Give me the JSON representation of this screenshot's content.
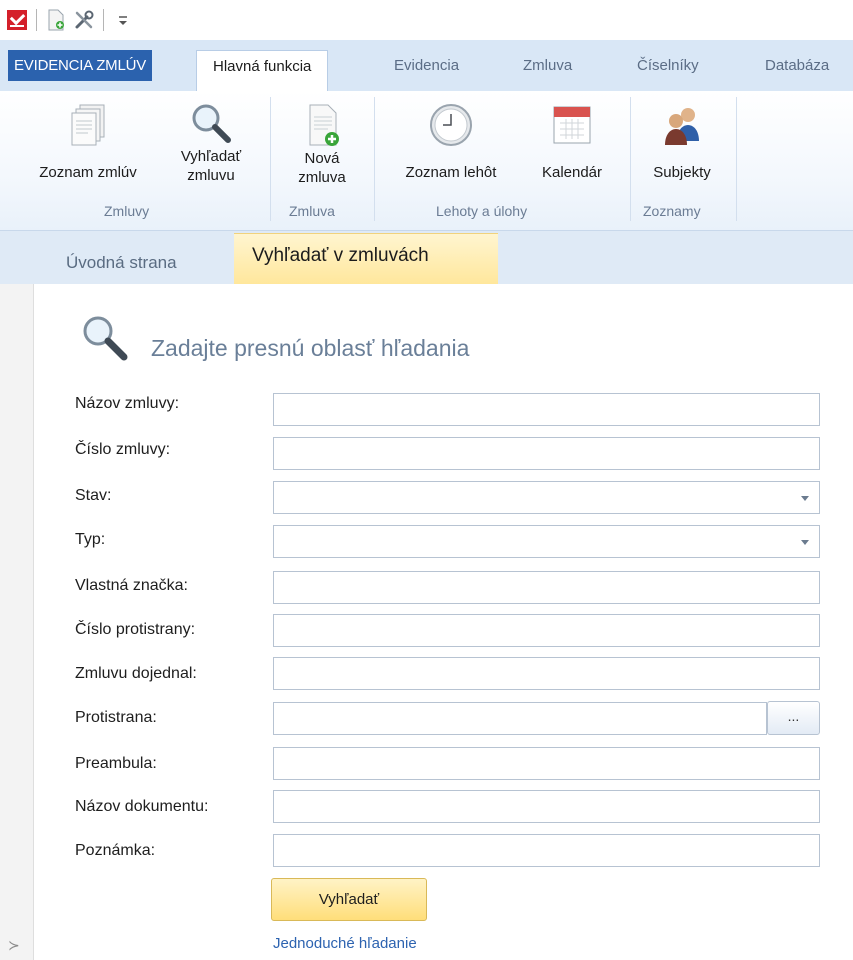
{
  "app_tab": "EVIDENCIA ZMLÚV",
  "ribbon_tabs": [
    "Hlavná funkcia",
    "Evidencia",
    "Zmluva",
    "Číselníky",
    "Databáza"
  ],
  "ribbon": {
    "buttons": {
      "contracts_list": "Zoznam zmlúv",
      "search_contract_1": "Vyhľadať",
      "search_contract_2": "zmluvu",
      "new_contract_1": "Nová",
      "new_contract_2": "zmluva",
      "deadlines_list": "Zoznam lehôt",
      "calendar": "Kalendár",
      "subjects": "Subjekty"
    },
    "groups": {
      "contracts": "Zmluvy",
      "contract": "Zmluva",
      "deadlines": "Lehoty a úlohy",
      "lists": "Zoznamy"
    }
  },
  "doc_tabs": {
    "home": "Úvodná strana",
    "search": "Vyhľadať v zmluvách"
  },
  "form": {
    "title": "Zadajte presnú oblasť hľadania",
    "fields": {
      "contract_name": "Názov zmluvy:",
      "contract_number": "Číslo zmluvy:",
      "status": "Stav:",
      "type": "Typ:",
      "own_mark": "Vlastná značka:",
      "counterparty_number": "Číslo protistrany:",
      "negotiated_by": "Zmluvu dojednal:",
      "counterparty": "Protistrana:",
      "preamble": "Preambula:",
      "document_name": "Názov dokumentu:",
      "note": "Poznámka:"
    },
    "values": {
      "contract_name": "",
      "contract_number": "",
      "status": "",
      "type": "",
      "own_mark": "",
      "counterparty_number": "",
      "negotiated_by": "",
      "counterparty": "",
      "preamble": "",
      "document_name": "",
      "note": ""
    },
    "browse_label": "...",
    "search_button": "Vyhľadať",
    "simple_search_link": "Jednoduché hľadanie"
  },
  "colors": {
    "ribbon_bg": "#d9e7f6",
    "app_tab": "#2b62ae",
    "active_doc_tab": "#ffe79c",
    "link": "#2d63b0",
    "title_text": "#6a7f98"
  }
}
